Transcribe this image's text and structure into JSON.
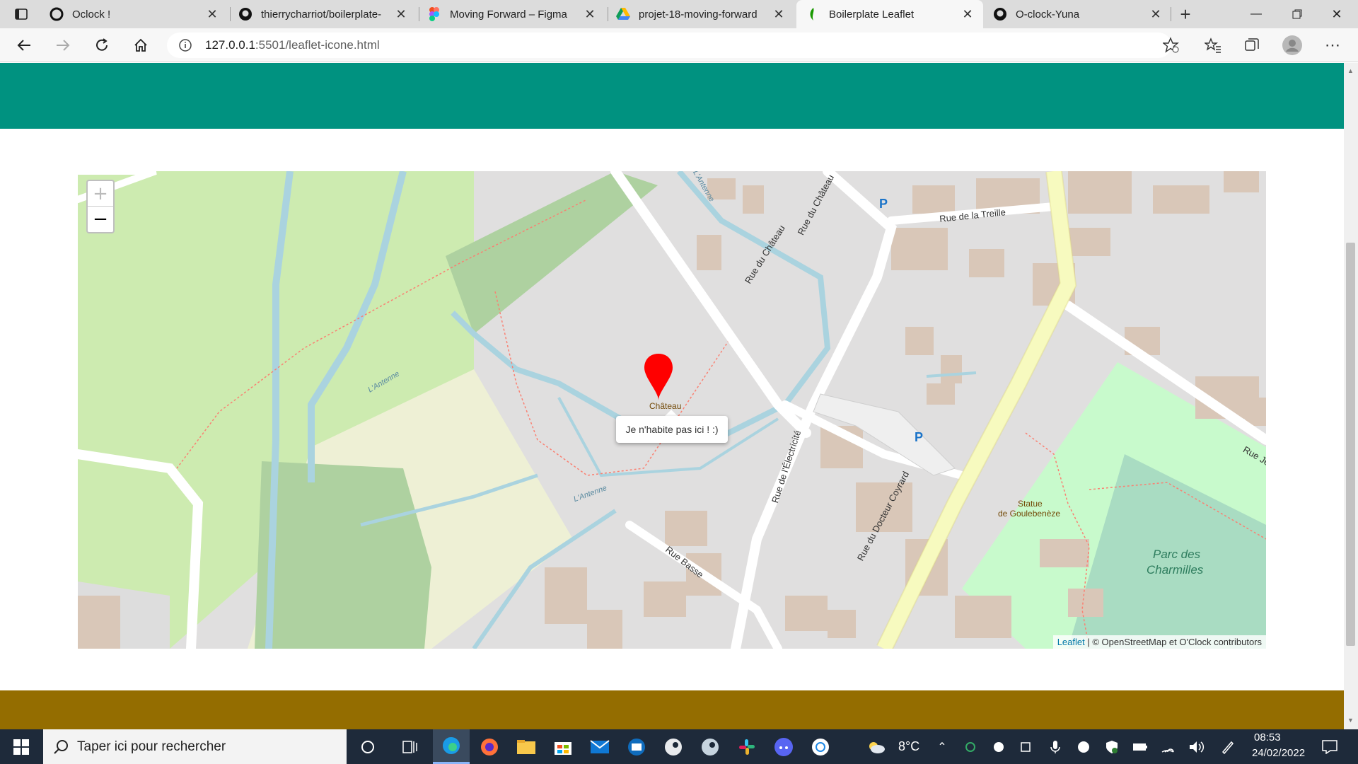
{
  "browser": {
    "tabs": [
      {
        "title": "Oclock !",
        "icon": "oclock-icon",
        "active": false
      },
      {
        "title": "thierrycharriot/boilerplate-le",
        "icon": "github-icon",
        "active": false
      },
      {
        "title": "Moving Forward – Figma",
        "icon": "figma-icon",
        "active": false
      },
      {
        "title": "projet-18-moving-forward -",
        "icon": "google-drive-icon",
        "active": false
      },
      {
        "title": "Boilerplate Leaflet",
        "icon": "leaflet-icon",
        "active": true
      },
      {
        "title": "O-clock-Yuna",
        "icon": "github-icon",
        "active": false
      }
    ],
    "address": {
      "host": "127.0.0.1",
      "path": ":5501/leaflet-icone.html"
    }
  },
  "map": {
    "zoom_in_label": "+",
    "zoom_out_label": "−",
    "popup_text": "Je n'habite pas ici ! :)",
    "attribution_link": "Leaflet",
    "attribution_text": " | © OpenStreetMap et O'Clock contributors",
    "labels": {
      "rue_du_chateau_1": "Rue du Château",
      "rue_du_chateau_2": "Rue du Château",
      "rue_de_la_treille": "Rue de la Treille",
      "rue_de_lelectricite": "Rue de l'Électricité",
      "rue_basse": "Rue Basse",
      "rue_du_docteur_coyrard": "Rue du Docteur Coyrard",
      "lantenne_1": "L'Antenne",
      "lantenne_2": "L'Antenne",
      "lantenne_3": "L'Antenne",
      "chateau": "Château",
      "statue": "Statue",
      "statue_2": "de Goulebenèze",
      "parc_1": "Parc des",
      "parc_2": "Charmilles",
      "rue_je": "Rue Je",
      "parking": "P"
    },
    "marker_color": "#ff0000"
  },
  "page": {
    "header_color": "#009280",
    "footer_color": "#946d00"
  },
  "taskbar": {
    "search_placeholder": "Taper ici pour rechercher",
    "weather": "8°C",
    "time": "08:53",
    "date": "24/02/2022"
  }
}
